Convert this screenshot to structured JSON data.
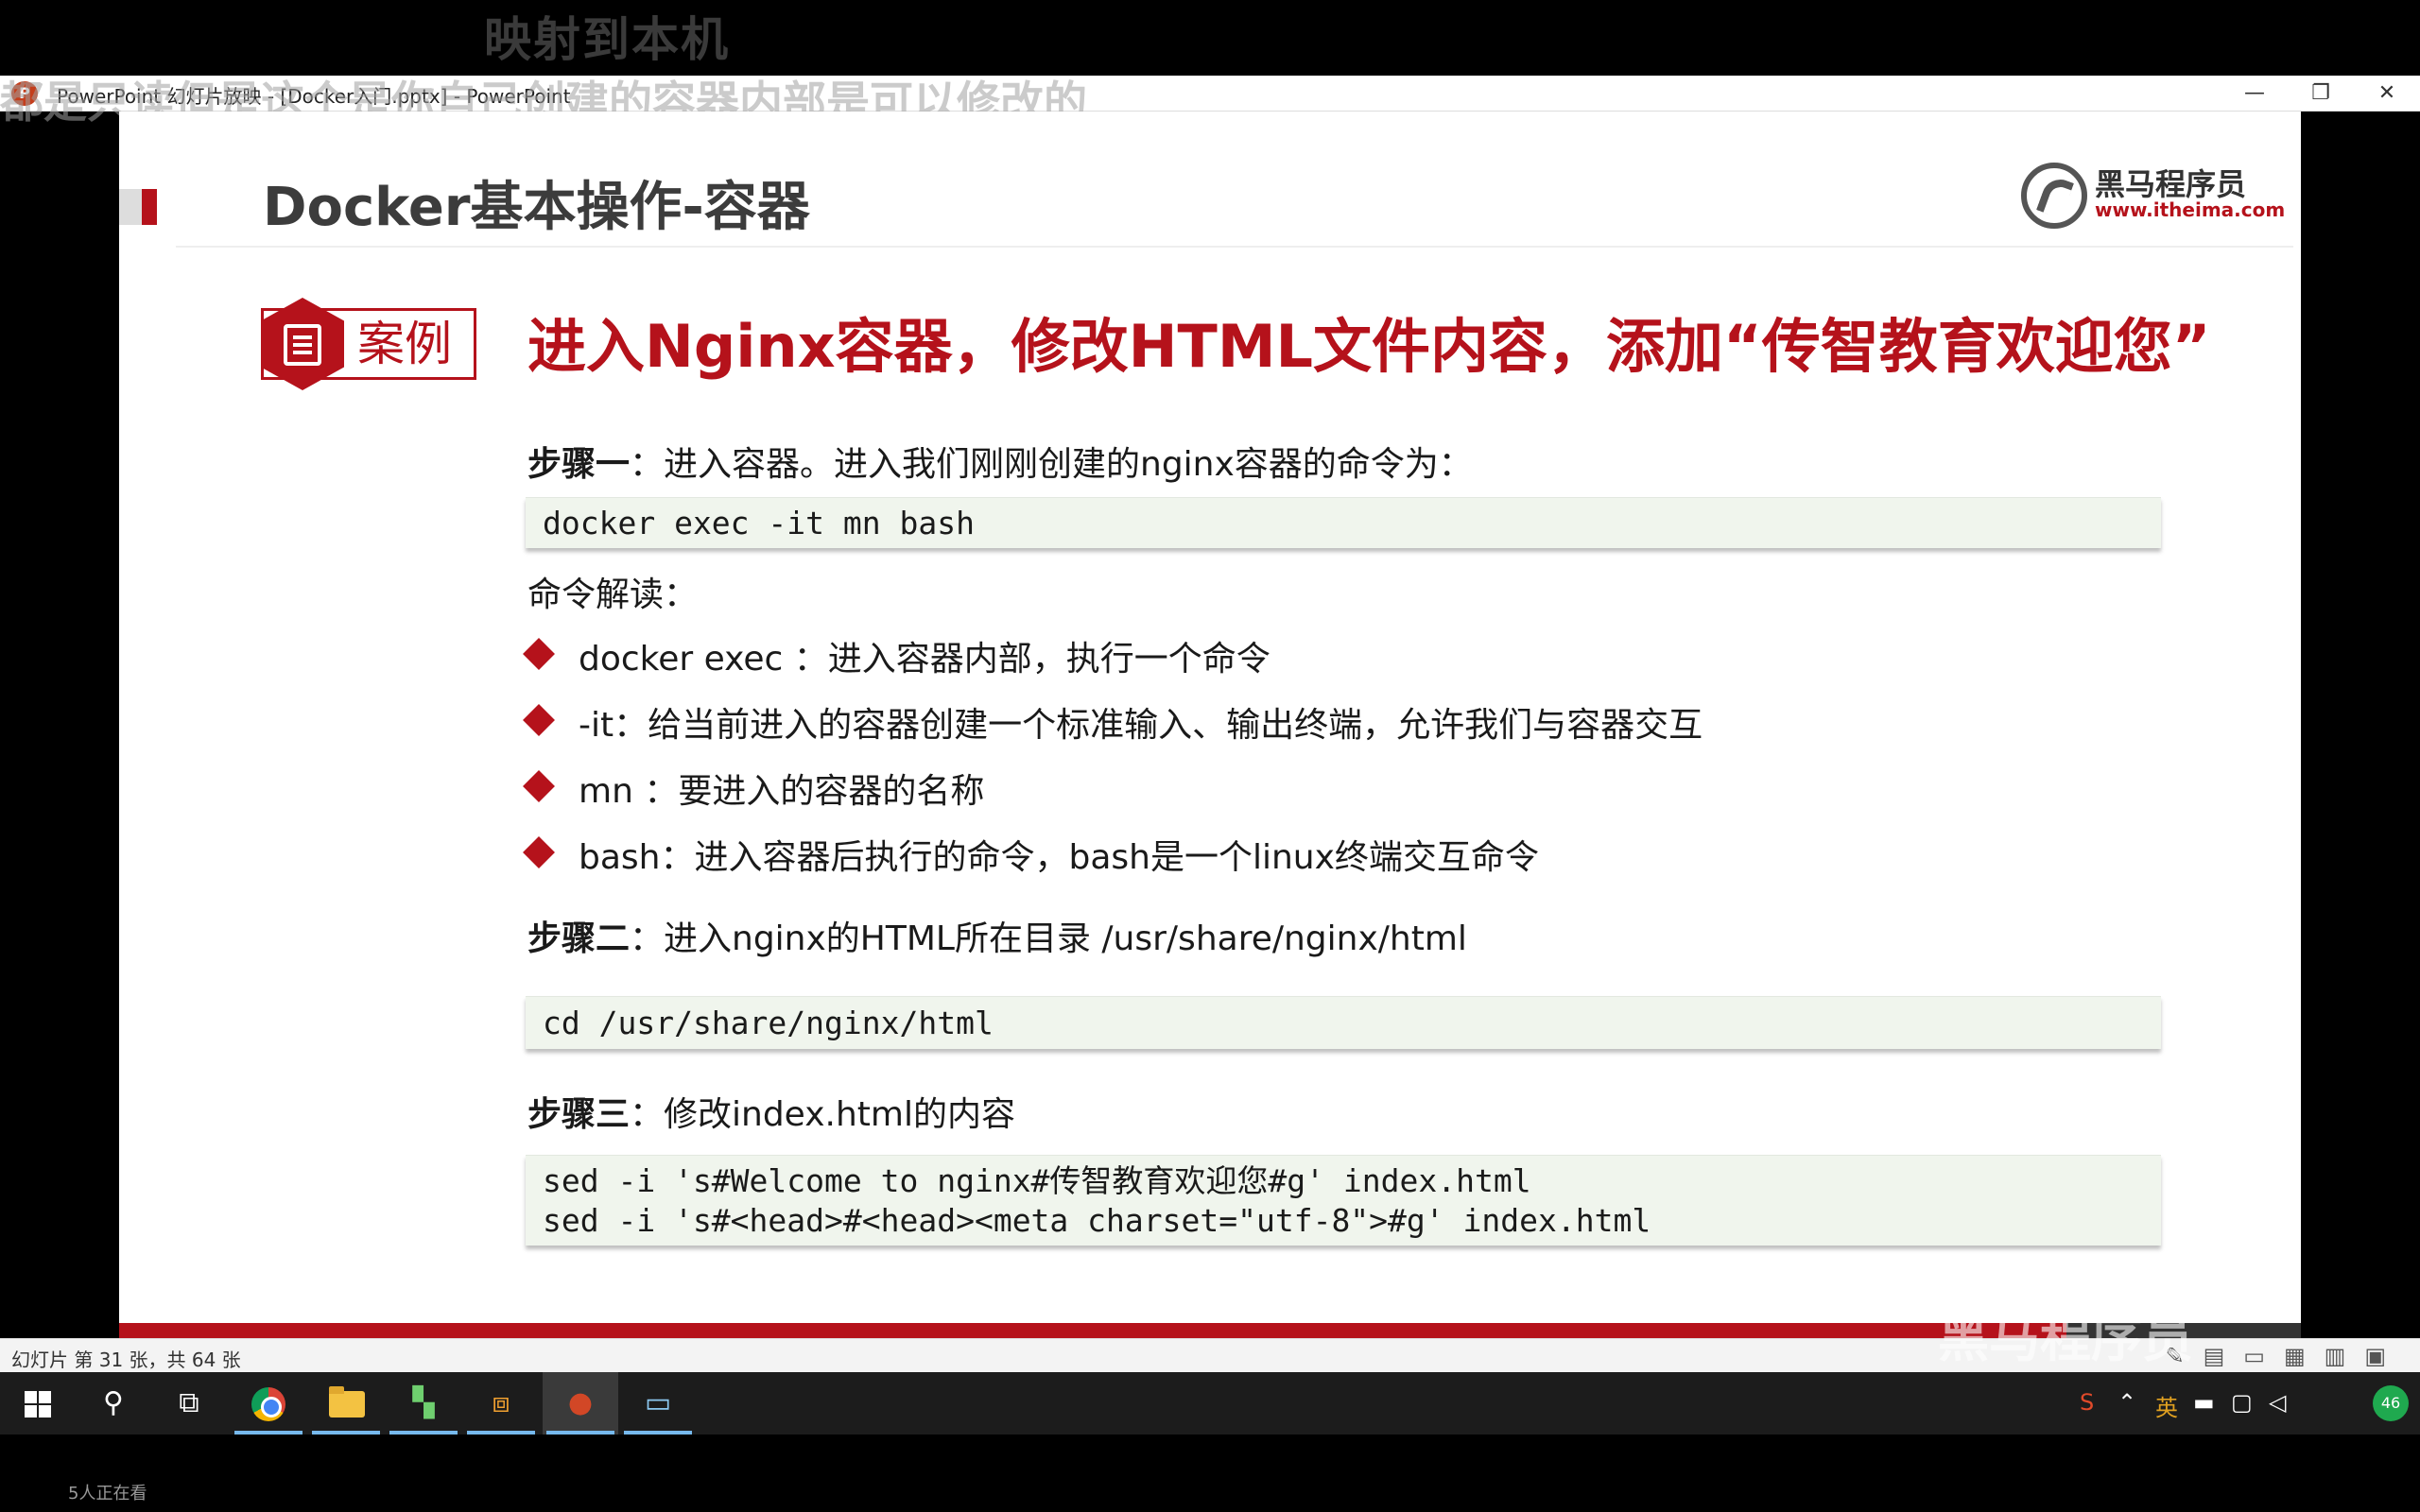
{
  "top_subtitle": "映射到本机",
  "overlay_caption": "都是只读但是这个是你自己创建的容器内部是可以修改的",
  "window": {
    "app_icon": "P",
    "title": "PowerPoint 幻灯片放映 - [Docker入门.pptx] - PowerPoint",
    "minimize": "—",
    "restore": "❐",
    "close": "✕"
  },
  "slide": {
    "title": "Docker基本操作-容器",
    "logo": {
      "name": "黑马程序员",
      "url": "www.itheima.com"
    },
    "case_label": "案例",
    "case_heading": "进入Nginx容器，修改HTML文件内容，添加“传智教育欢迎您”",
    "step1": {
      "label": "步骤一",
      "text": "：进入容器。进入我们刚刚创建的nginx容器的命令为："
    },
    "code1": [
      "docker exec -it mn bash"
    ],
    "explain_label": "命令解读：",
    "bullets": [
      "docker exec ：进入容器内部，执行一个命令",
      "-it：给当前进入的容器创建一个标准输入、输出终端，允许我们与容器交互",
      "mn ：要进入的容器的名称",
      "bash：进入容器后执行的命令，bash是一个linux终端交互命令"
    ],
    "step2": {
      "label": "步骤二",
      "text": "：进入nginx的HTML所在目录 /usr/share/nginx/html"
    },
    "code2": [
      "cd /usr/share/nginx/html"
    ],
    "step3": {
      "label": "步骤三",
      "text": "：修改index.html的内容"
    },
    "code3": [
      "sed -i 's#Welcome to nginx#传智教育欢迎您#g' index.html",
      "sed -i 's#<head>#<head><meta charset=\"utf-8\">#g' index.html"
    ]
  },
  "statusbar": {
    "slide_info": "幻灯片 第 31 张，共 64 张"
  },
  "taskbar": {
    "tray_ime": "英",
    "tray_badge": "46"
  },
  "viewers": "5人正在看",
  "watermark": "黑马程序员"
}
